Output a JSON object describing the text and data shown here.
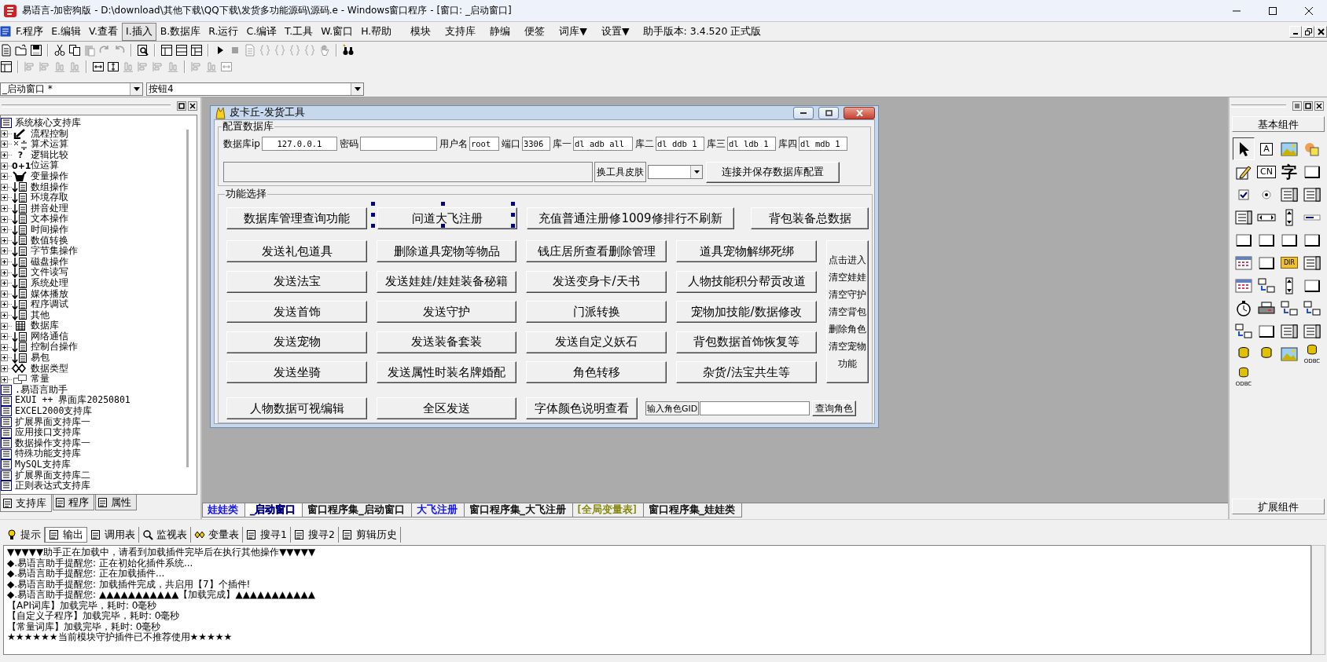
{
  "window": {
    "title": "易语言-加密狗版 - D:\\download\\其他下载\\QQ下载\\发货多功能源码\\源码.e - Windows窗口程序 - [窗口: _启动窗口]"
  },
  "menu": [
    {
      "label": "F.程序",
      "selected": false
    },
    {
      "label": "E.编辑",
      "selected": false
    },
    {
      "label": "V.查看",
      "selected": false
    },
    {
      "label": "I.插入",
      "selected": true
    },
    {
      "label": "B.数据库",
      "selected": false
    },
    {
      "label": "R.运行",
      "selected": false
    },
    {
      "label": "C.编译",
      "selected": false
    },
    {
      "label": "T.工具",
      "selected": false
    },
    {
      "label": "W.窗口",
      "selected": false
    },
    {
      "label": "H.帮助",
      "selected": false
    }
  ],
  "menu_extras": [
    "模块",
    "支持库",
    "静编",
    "便签",
    "词库▼",
    "设置▼"
  ],
  "version": "助手版本: 3.4.520 正式版",
  "selectors": {
    "window": "_启动窗口 *",
    "control": "按钮4"
  },
  "support_tree": {
    "label": "系统核心支持库",
    "children": [
      {
        "label": "流程控制",
        "kind": "flow"
      },
      {
        "label": "算术运算",
        "kind": "math"
      },
      {
        "label": "逻辑比较",
        "kind": "glyph",
        "glyph": "?"
      },
      {
        "label": "位运算",
        "kind": "glyph",
        "glyph": "0+1"
      },
      {
        "label": "变量操作",
        "kind": "variable"
      },
      {
        "label": "数组操作",
        "kind": "module"
      },
      {
        "label": "环境存取",
        "kind": "module"
      },
      {
        "label": "拼音处理",
        "kind": "module"
      },
      {
        "label": "文本操作",
        "kind": "module"
      },
      {
        "label": "时间操作",
        "kind": "module"
      },
      {
        "label": "数值转换",
        "kind": "module"
      },
      {
        "label": "字节集操作",
        "kind": "module"
      },
      {
        "label": "磁盘操作",
        "kind": "module"
      },
      {
        "label": "文件读写",
        "kind": "module"
      },
      {
        "label": "系统处理",
        "kind": "module"
      },
      {
        "label": "媒体播放",
        "kind": "module"
      },
      {
        "label": "程序调试",
        "kind": "module"
      },
      {
        "label": "其他",
        "kind": "module"
      },
      {
        "label": "数据库",
        "kind": "database"
      },
      {
        "label": "网络通信",
        "kind": "module"
      },
      {
        "label": "控制台操作",
        "kind": "module"
      },
      {
        "label": "易包",
        "kind": "module"
      },
      {
        "label": "数据类型",
        "kind": "datatype"
      },
      {
        "label": "常量",
        "kind": "constant"
      }
    ]
  },
  "libraries": [
    ".易语言助手",
    "EXUI ++ 界面库20250801",
    "EXCEL2000支持库",
    "扩展界面支持库一",
    "应用接口支持库",
    "数据操作支持库一",
    "特殊功能支持库",
    "MySQL支持库",
    "扩展界面支持库二",
    "正则表达式支持库"
  ],
  "left_tabs": [
    {
      "label": "支持库",
      "selected": true
    },
    {
      "label": "程序",
      "selected": false
    },
    {
      "label": "属性",
      "selected": false
    }
  ],
  "form": {
    "title": "皮卡丘-发货工具",
    "db_group": {
      "title": "配置数据库",
      "fields": [
        {
          "label": "数据库ip",
          "value": "127.0.0.1"
        },
        {
          "label": "密码"
        },
        {
          "label": "用户名",
          "value": "root"
        },
        {
          "label": "端口",
          "value": "3306"
        },
        {
          "label": "库一",
          "value": "dl_adb_all"
        },
        {
          "label": "库二",
          "value": "dl_ddb_1"
        },
        {
          "label": "库三",
          "value": "dl_ldb_1"
        },
        {
          "label": "库四",
          "value": "dl_mdb_1"
        }
      ],
      "skin_label": "换工具皮肤",
      "connect_button": "连接并保存数据库配置"
    },
    "func_group": {
      "title": "功能选择",
      "top_buttons": [
        {
          "label": "数据库管理查询功能",
          "selected": false
        },
        {
          "label": "问道大飞注册",
          "selected": true
        },
        {
          "label": "充值普通注册修1009修排行不刷新",
          "selected": false
        },
        {
          "label": "背包装备总数据",
          "selected": false
        }
      ],
      "grid": [
        [
          "发送礼包道具",
          "删除道具宠物等物品",
          "钱庄居所查看删除管理",
          "道具宠物解绑死绑"
        ],
        [
          "发送法宝",
          "发送娃娃/娃娃装备秘籍",
          "发送变身卡/天书",
          "人物技能积分帮贡改道"
        ],
        [
          "发送首饰",
          "发送守护",
          "门派转换",
          "宠物加技能/数据修改"
        ],
        [
          "发送宠物",
          "发送装备套装",
          "发送自定义妖石",
          "背包数据首饰恢复等"
        ],
        [
          "发送坐骑",
          "发送属性时装名牌婚配",
          "角色转移",
          "杂货/法宝共生等"
        ]
      ],
      "side_button": [
        "点击进入",
        "清空娃娃",
        "清空守护",
        "清空背包",
        "删除角色",
        "清空宠物",
        "功能"
      ],
      "bottom_buttons": [
        "人物数据可视编辑",
        "全区发送",
        "字体颜色说明查看"
      ],
      "gid_label": "输入角色GID",
      "query_button": "查询角色"
    }
  },
  "doc_tabs": [
    {
      "label": "娃娃类",
      "selected": false,
      "color": "#0000ff"
    },
    {
      "label": "_启动窗口",
      "selected": true,
      "color": "#000080"
    },
    {
      "label": "窗口程序集_启动窗口",
      "selected": false,
      "color": "#000000"
    },
    {
      "label": "大飞注册",
      "selected": false,
      "color": "#0000ff"
    },
    {
      "label": "窗口程序集_大飞注册",
      "selected": false,
      "color": "#000000"
    },
    {
      "label": "[全局变量表]",
      "selected": false,
      "color": "#808000"
    },
    {
      "label": "窗口程序集_娃娃类",
      "selected": false,
      "color": "#000000"
    }
  ],
  "palette": {
    "header": "基本组件",
    "footer": "扩展组件",
    "tools": [
      {
        "kind": "pointer",
        "selected": true
      },
      {
        "kind": "text",
        "text": "A",
        "selected": false
      },
      {
        "kind": "picture",
        "selected": false
      },
      {
        "kind": "shapes",
        "selected": false
      },
      {
        "kind": "pencil",
        "selected": false
      },
      {
        "kind": "text",
        "text": "CN",
        "selected": false
      },
      {
        "kind": "glyph",
        "text": "字",
        "selected": false
      },
      {
        "kind": "frame",
        "selected": false
      },
      {
        "kind": "checkbox",
        "selected": false
      },
      {
        "kind": "radio",
        "selected": false
      },
      {
        "kind": "list",
        "selected": false
      },
      {
        "kind": "list",
        "selected": false
      },
      {
        "kind": "list",
        "selected": false
      },
      {
        "kind": "scroll",
        "selected": false
      },
      {
        "kind": "spin",
        "selected": false
      },
      {
        "kind": "progress",
        "selected": false
      },
      {
        "kind": "frame",
        "selected": false
      },
      {
        "kind": "frame",
        "selected": false
      },
      {
        "kind": "frame",
        "selected": false
      },
      {
        "kind": "frame",
        "selected": false
      },
      {
        "kind": "calendar",
        "selected": false
      },
      {
        "kind": "frame",
        "selected": false
      },
      {
        "kind": "folder",
        "text": "DIR",
        "selected": false
      },
      {
        "kind": "list",
        "selected": false
      },
      {
        "kind": "calendar",
        "selected": false
      },
      {
        "kind": "computer",
        "selected": false
      },
      {
        "kind": "spin",
        "selected": false
      },
      {
        "kind": "frame",
        "selected": false
      },
      {
        "kind": "clock",
        "selected": false
      },
      {
        "kind": "printer",
        "selected": false
      },
      {
        "kind": "computer",
        "selected": false
      },
      {
        "kind": "computer",
        "selected": false
      },
      {
        "kind": "computer",
        "selected": false
      },
      {
        "kind": "frame",
        "selected": false
      },
      {
        "kind": "list",
        "selected": false
      },
      {
        "kind": "list",
        "selected": false
      },
      {
        "kind": "database",
        "selected": false
      },
      {
        "kind": "database",
        "selected": false
      },
      {
        "kind": "picture",
        "selected": false
      },
      {
        "kind": "database",
        "text": "ODBC",
        "selected": false
      },
      {
        "kind": "database",
        "text": "ODBC",
        "selected": false
      }
    ]
  },
  "output_tabs": [
    {
      "label": "提示",
      "selected": false
    },
    {
      "label": "输出",
      "selected": true
    },
    {
      "label": "调用表",
      "selected": false
    },
    {
      "label": "监视表",
      "selected": false
    },
    {
      "label": "变量表",
      "selected": false
    },
    {
      "label": "搜寻1",
      "selected": false
    },
    {
      "label": "搜寻2",
      "selected": false
    },
    {
      "label": "剪辑历史",
      "selected": false
    }
  ],
  "output": [
    "▼▼▼▼▼助手正在加载中，请看到加载插件完毕后在执行其他操作▼▼▼▼▼",
    "◆.易语言助手提醒您: 正在初始化插件系统...",
    "◆.易语言助手提醒您: 正在加载插件...",
    "◆.易语言助手提醒您: 加载插件完成，共启用【7】个插件!",
    "◆.易语言助手提醒您: ▲▲▲▲▲▲▲▲▲▲▲【加载完成】▲▲▲▲▲▲▲▲▲▲▲",
    "【API词库】加载完毕，耗时: 0毫秒",
    "【自定义子程序】加载完毕，耗时: 0毫秒",
    "【常量词库】加载完毕，耗时: 0毫秒",
    "★★★★★★当前模块守护插件已不推荐使用★★★★★"
  ]
}
